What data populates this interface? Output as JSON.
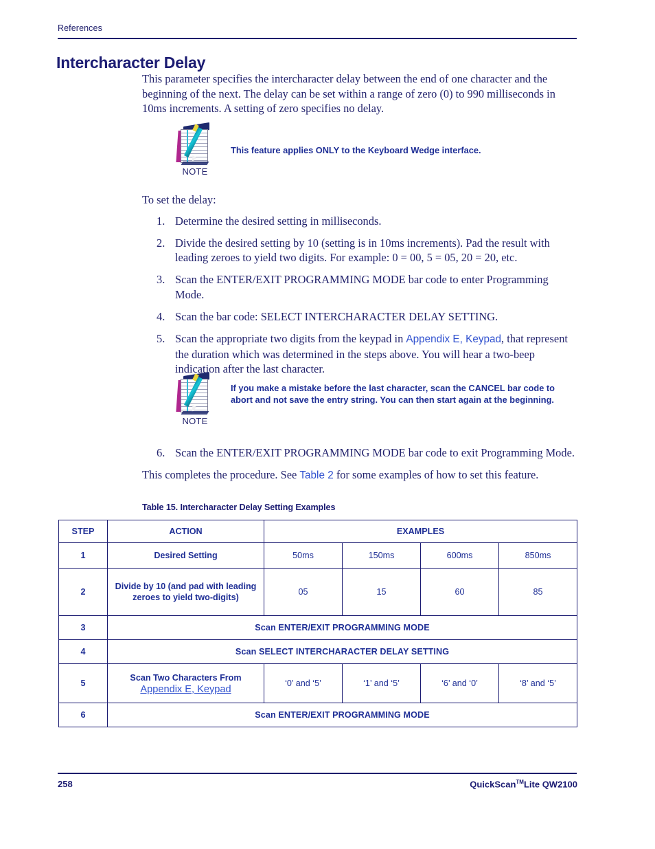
{
  "header": {
    "running_head": "References",
    "title": "Intercharacter Delay"
  },
  "body": {
    "intro": "This parameter specifies the intercharacter delay between the end of one character and the beginning of the next. The delay can be set within a range of zero (0) to 990 milliseconds in 10ms increments. A setting of zero specifies no delay.",
    "to_set": "To set the delay:",
    "completes_prefix": "This completes the procedure. See ",
    "completes_link": "Table 2",
    "completes_suffix": " for some examples of how to set this feature."
  },
  "notes": [
    {
      "label": "NOTE",
      "icon": "notepad-pencil-icon",
      "text": "This feature applies ONLY to the Keyboard Wedge interface."
    },
    {
      "label": "NOTE",
      "icon": "notepad-pencil-icon",
      "text": "If you make a mistake before the last character, scan the CANCEL bar code to abort and not save the entry string. You can then start again at the beginning."
    }
  ],
  "steps": [
    {
      "num": "1.",
      "text": "Determine the desired setting in milliseconds."
    },
    {
      "num": "2.",
      "text": "Divide the desired setting by 10 (setting is in 10ms increments). Pad the result with leading zeroes to yield two digits. For example: 0 = 00, 5 = 05, 20 = 20, etc."
    },
    {
      "num": "3.",
      "text": "Scan the ENTER/EXIT PROGRAMMING MODE bar code to enter Programming Mode."
    },
    {
      "num": "4.",
      "text": "Scan the bar code: SELECT INTERCHARACTER DELAY SETTING."
    },
    {
      "num": "5.",
      "text_before": "Scan the appropriate two digits from the keypad in ",
      "link": "Appendix E, Keypad",
      "text_after": ", that represent the duration which was determined in the steps above. You will hear a two-beep indication after the last character."
    },
    {
      "num": "6.",
      "text": "Scan the ENTER/EXIT PROGRAMMING MODE bar code to exit Programming Mode."
    }
  ],
  "table": {
    "caption": "Table 15. Intercharacter Delay Setting Examples",
    "headers": {
      "step": "STEP",
      "action": "ACTION",
      "examples": "EXAMPLES"
    },
    "rows": [
      {
        "step": "1",
        "action": "Desired Setting",
        "examples": [
          "50ms",
          "150ms",
          "600ms",
          "850ms"
        ]
      },
      {
        "step": "2",
        "action": "Divide by 10 (and pad with leading zeroes to yield two-digits)",
        "examples": [
          "05",
          "15",
          "60",
          "85"
        ]
      },
      {
        "step": "3",
        "full": "Scan ENTER/EXIT PROGRAMMING MODE"
      },
      {
        "step": "4",
        "full": "Scan SELECT INTERCHARACTER DELAY SETTING"
      },
      {
        "step": "5",
        "action": "Scan Two Characters From",
        "action_link": "Appendix E, Keypad",
        "examples": [
          "‘0’ and ‘5’",
          "‘1’ and ‘5’",
          "‘6’ and ‘0’",
          "‘8’ and ‘5’"
        ]
      },
      {
        "step": "6",
        "full": "Scan ENTER/EXIT PROGRAMMING MODE"
      }
    ]
  },
  "footer": {
    "page_number": "258",
    "product_name": "QuickScan",
    "product_tm": "TM",
    "product_model": "Lite QW2100"
  },
  "colors": {
    "navy": "#1b1b72",
    "body_text": "#23236d",
    "link": "#2f50cf",
    "note_text": "#1f2f96"
  }
}
